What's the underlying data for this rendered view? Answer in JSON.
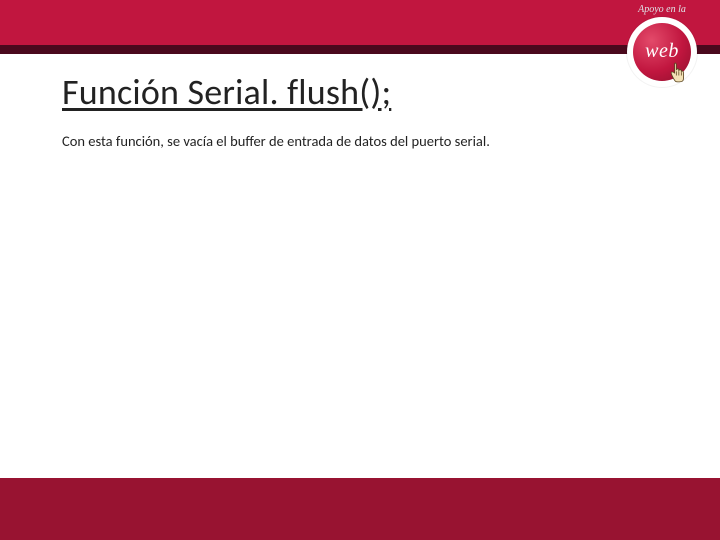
{
  "header": {
    "apoyo_text": "Apoyo en la",
    "badge_text": "web"
  },
  "content": {
    "title": "Función Serial. flush();",
    "body": "Con esta función, se vacía el buffer de entrada de datos del puerto serial."
  },
  "colors": {
    "top_bar": "#c1163f",
    "top_dark": "#4a091d",
    "bottom_bar": "#981331"
  }
}
